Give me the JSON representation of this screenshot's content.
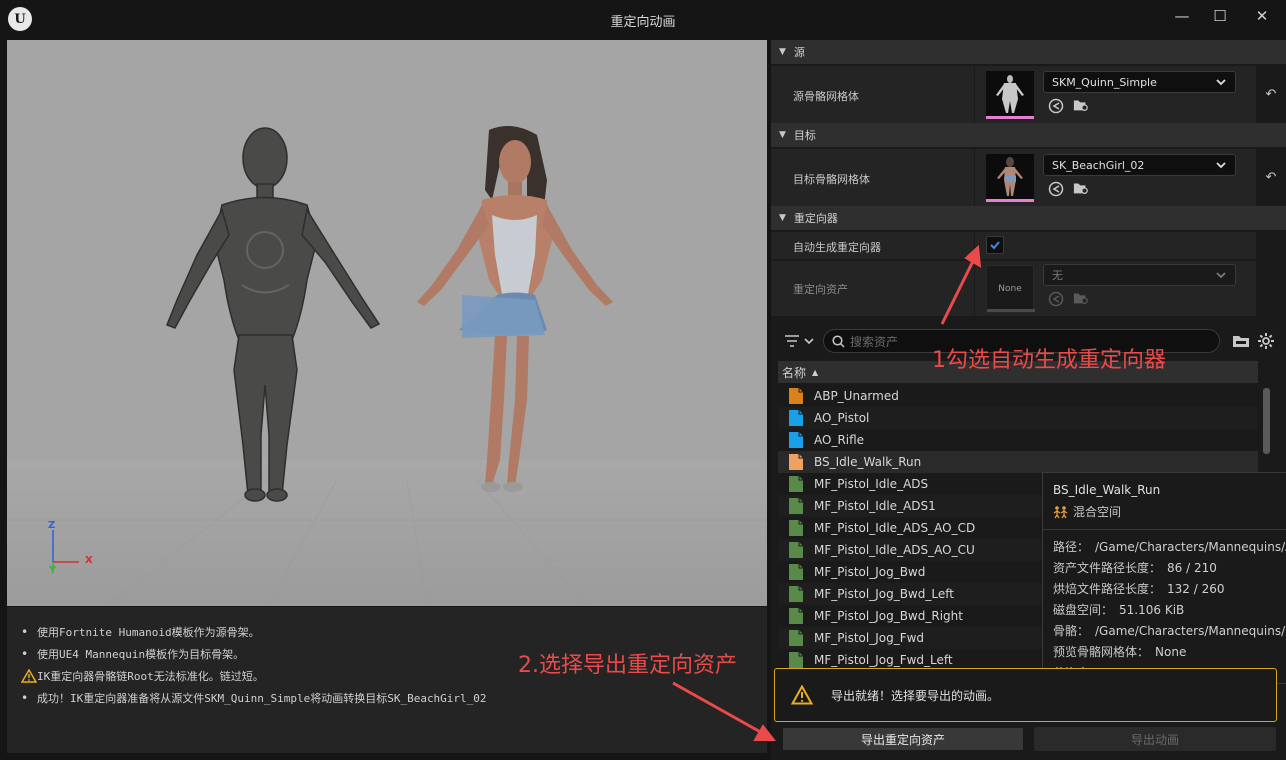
{
  "window": {
    "title": "重定向动画",
    "logo": "U",
    "minimize": "—",
    "maximize": "☐",
    "close": "✕"
  },
  "viewport": {
    "axis": {
      "z": "Z",
      "x": "X",
      "y": "Y"
    }
  },
  "log": {
    "lines": [
      {
        "type": "info",
        "text": "使用Fortnite Humanoid模板作为源骨架。"
      },
      {
        "type": "info",
        "text": "使用UE4 Mannequin模板作为目标骨架。"
      },
      {
        "type": "warning",
        "text": "IK重定向器骨骼链Root无法标准化。链过短。"
      },
      {
        "type": "info",
        "text": "成功！IK重定向器准备将从源文件SKM_Quinn_Simple将动画转换目标SK_BeachGirl_02"
      }
    ]
  },
  "details": {
    "source": {
      "header": "源",
      "label": "源骨骼网格体",
      "value": "SKM_Quinn_Simple"
    },
    "target": {
      "header": "目标",
      "label": "目标骨骼网格体",
      "value": "SK_BeachGirl_02"
    },
    "retargeter": {
      "header": "重定向器",
      "auto_label": "自动生成重定向器",
      "auto_checked": true,
      "asset_label": "重定向资产",
      "asset_value": "无",
      "asset_thumb": "None"
    }
  },
  "asset_browser": {
    "search_placeholder": "搜索资产",
    "column_name": "名称",
    "items": [
      {
        "name": "ABP_Unarmed",
        "color": "#d9811a"
      },
      {
        "name": "AO_Pistol",
        "color": "#1aa0e8"
      },
      {
        "name": "AO_Rifle",
        "color": "#1aa0e8"
      },
      {
        "name": "BS_Idle_Walk_Run",
        "color": "#f0a060"
      },
      {
        "name": "MF_Pistol_Idle_ADS",
        "color": "#5a8a4a"
      },
      {
        "name": "MF_Pistol_Idle_ADS1",
        "color": "#5a8a4a"
      },
      {
        "name": "MF_Pistol_Idle_ADS_AO_CD",
        "color": "#5a8a4a"
      },
      {
        "name": "MF_Pistol_Idle_ADS_AO_CU",
        "color": "#5a8a4a"
      },
      {
        "name": "MF_Pistol_Jog_Bwd",
        "color": "#5a8a4a"
      },
      {
        "name": "MF_Pistol_Jog_Bwd_Left",
        "color": "#5a8a4a"
      },
      {
        "name": "MF_Pistol_Jog_Bwd_Right",
        "color": "#5a8a4a"
      },
      {
        "name": "MF_Pistol_Jog_Fwd",
        "color": "#5a8a4a"
      },
      {
        "name": "MF_Pistol_Jog_Fwd_Left",
        "color": "#5a8a4a"
      }
    ]
  },
  "tooltip": {
    "title": "BS_Idle_Walk_Run",
    "type": "混合空间",
    "rows": [
      {
        "k": "路径：",
        "v": "/Game/Characters/Mannequins/A"
      },
      {
        "k": "资产文件路径长度：",
        "v": "86 / 210"
      },
      {
        "k": "烘焙文件路径长度：",
        "v": "132 / 260"
      },
      {
        "k": "磁盘空间：",
        "v": "51.106 KiB"
      },
      {
        "k": "骨骼：",
        "v": "/Game/Characters/Mannequins/M"
      },
      {
        "k": "预览骨骼网格体：",
        "v": "None"
      },
      {
        "k": "父资产：",
        "v": "None"
      }
    ]
  },
  "export": {
    "message": "导出就绪！选择要导出的动画。",
    "export_retarget_button": "导出重定向资产",
    "export_anim_button": "导出动画"
  },
  "annotations": {
    "step1": "1勾选自动生成重定向器",
    "step2": "2.选择导出重定向资产",
    "color": "#ea4a4a"
  }
}
